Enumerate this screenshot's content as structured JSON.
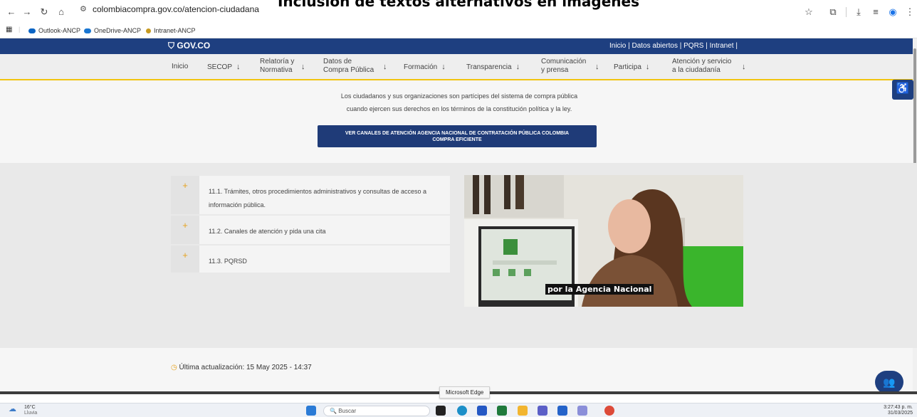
{
  "overlay_title": "Inclusión de textos alternativos en imágenes",
  "browser": {
    "url": "colombiacompra.gov.co/atencion-ciudadana",
    "bookmarks": [
      "Outlook-ANCP",
      "OneDrive-ANCP",
      "Intranet-ANCP"
    ],
    "icons": [
      "back-icon",
      "forward-icon",
      "reload-icon",
      "home-icon",
      "site-info-icon",
      "star-icon",
      "extensions-icon",
      "downloads-icon",
      "reading-list-icon",
      "profile-icon",
      "menu-icon"
    ]
  },
  "site": {
    "gov_logo": "GOV.CO",
    "gov_links": "Inicio | Datos abiertos | PQRS | Intranet |",
    "nav": [
      {
        "label": "Inicio"
      },
      {
        "label": "SECOP"
      },
      {
        "label_line1": "Relatoría y",
        "label_line2": "Normativa"
      },
      {
        "label_line1": "Datos de",
        "label_line2": "Compra Pública"
      },
      {
        "label": "Formación"
      },
      {
        "label": "Transparencia"
      },
      {
        "label_line1": "Comunicación",
        "label_line2": "y prensa"
      },
      {
        "label": "Participa"
      },
      {
        "label_line1": "Atención y servicio",
        "label_line2": "a la ciudadanía"
      }
    ],
    "intro_line1": "Los ciudadanos y sus organizaciones son partícipes del sistema de compra pública",
    "intro_line2": "cuando ejercen sus derechos en los términos de la constitución política y la ley.",
    "cta_line1": "VER CANALES DE ATENCIÓN AGENCIA NACIONAL DE CONTRATACIÓN PÚBLICA COLOMBIA",
    "cta_line2": "COMPRA EFICIENTE",
    "accordion": [
      {
        "symbol": "+",
        "label": "11.1. Trámites, otros procedimientos administrativos y consultas de acceso a información pública."
      },
      {
        "symbol": "+",
        "label": "11.2. Canales de atención y pida una cita"
      },
      {
        "symbol": "+",
        "label": "11.3. PQRSD"
      }
    ],
    "video_caption": "por la Agencia Nacional",
    "updated": "Última actualización: 15 May 2025 - 14:37"
  },
  "tooltip": "Microsoft Edge",
  "taskbar": {
    "temperature": "16°C",
    "weather": "Lluvia",
    "search_placeholder": "Buscar",
    "time": "3:27:43 p. m.",
    "date": "31/03/2025"
  },
  "colors": {
    "gov_blue": "#1e3f80",
    "nav_accent": "#f1c40f",
    "plus_orange": "#e6a31f"
  }
}
